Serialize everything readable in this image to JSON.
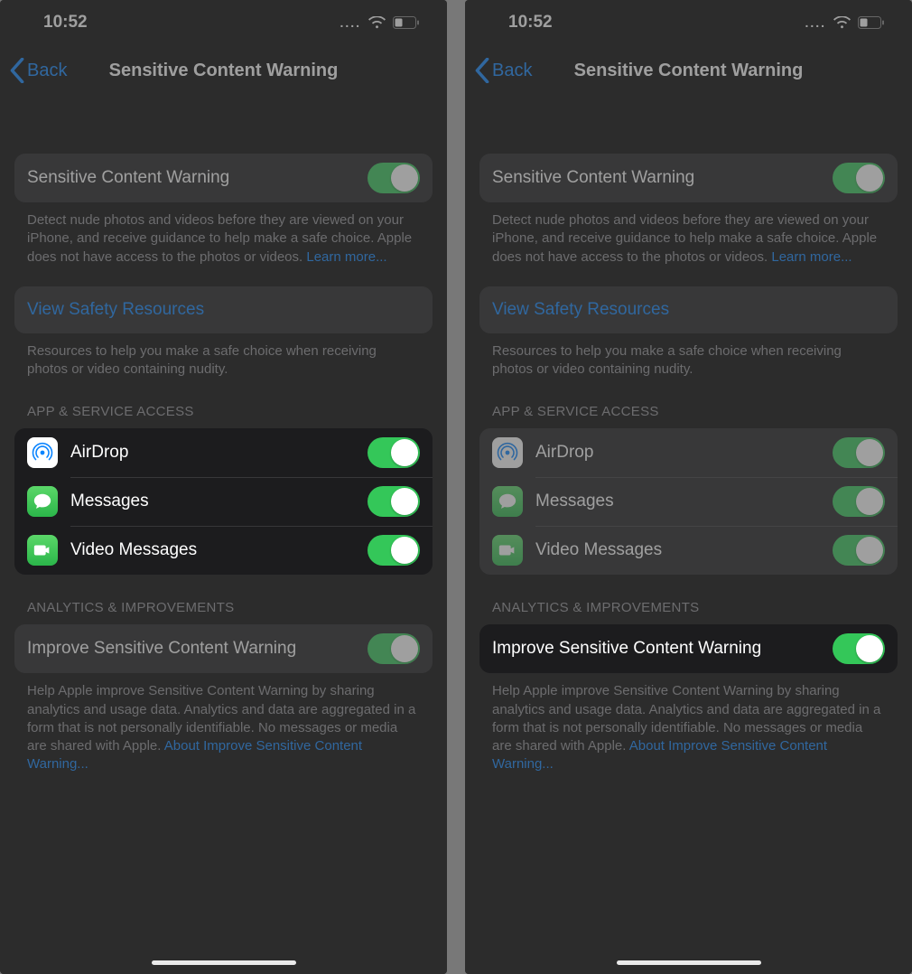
{
  "status": {
    "time": "10:52"
  },
  "nav": {
    "back": "Back",
    "title": "Sensitive Content Warning"
  },
  "main_toggle": {
    "label": "Sensitive Content Warning",
    "footer_pre": "Detect nude photos and videos before they are viewed on your iPhone, and receive guidance to help make a safe choice. Apple does not have access to the photos or videos. ",
    "learn_more": "Learn more..."
  },
  "safety": {
    "label": "View Safety Resources",
    "footer": "Resources to help you make a safe choice when receiving photos or video containing nudity."
  },
  "apps_header": "APP & SERVICE ACCESS",
  "apps": {
    "airdrop": "AirDrop",
    "messages": "Messages",
    "video": "Video Messages"
  },
  "analytics_header": "ANALYTICS & IMPROVEMENTS",
  "improve": {
    "label": "Improve Sensitive Content Warning",
    "footer_pre": "Help Apple improve Sensitive Content Warning by sharing analytics and usage data. Analytics and data are aggregated in a form that is not personally identifiable. No messages or media are shared with Apple. ",
    "link": "About Improve Sensitive Content Warning..."
  }
}
